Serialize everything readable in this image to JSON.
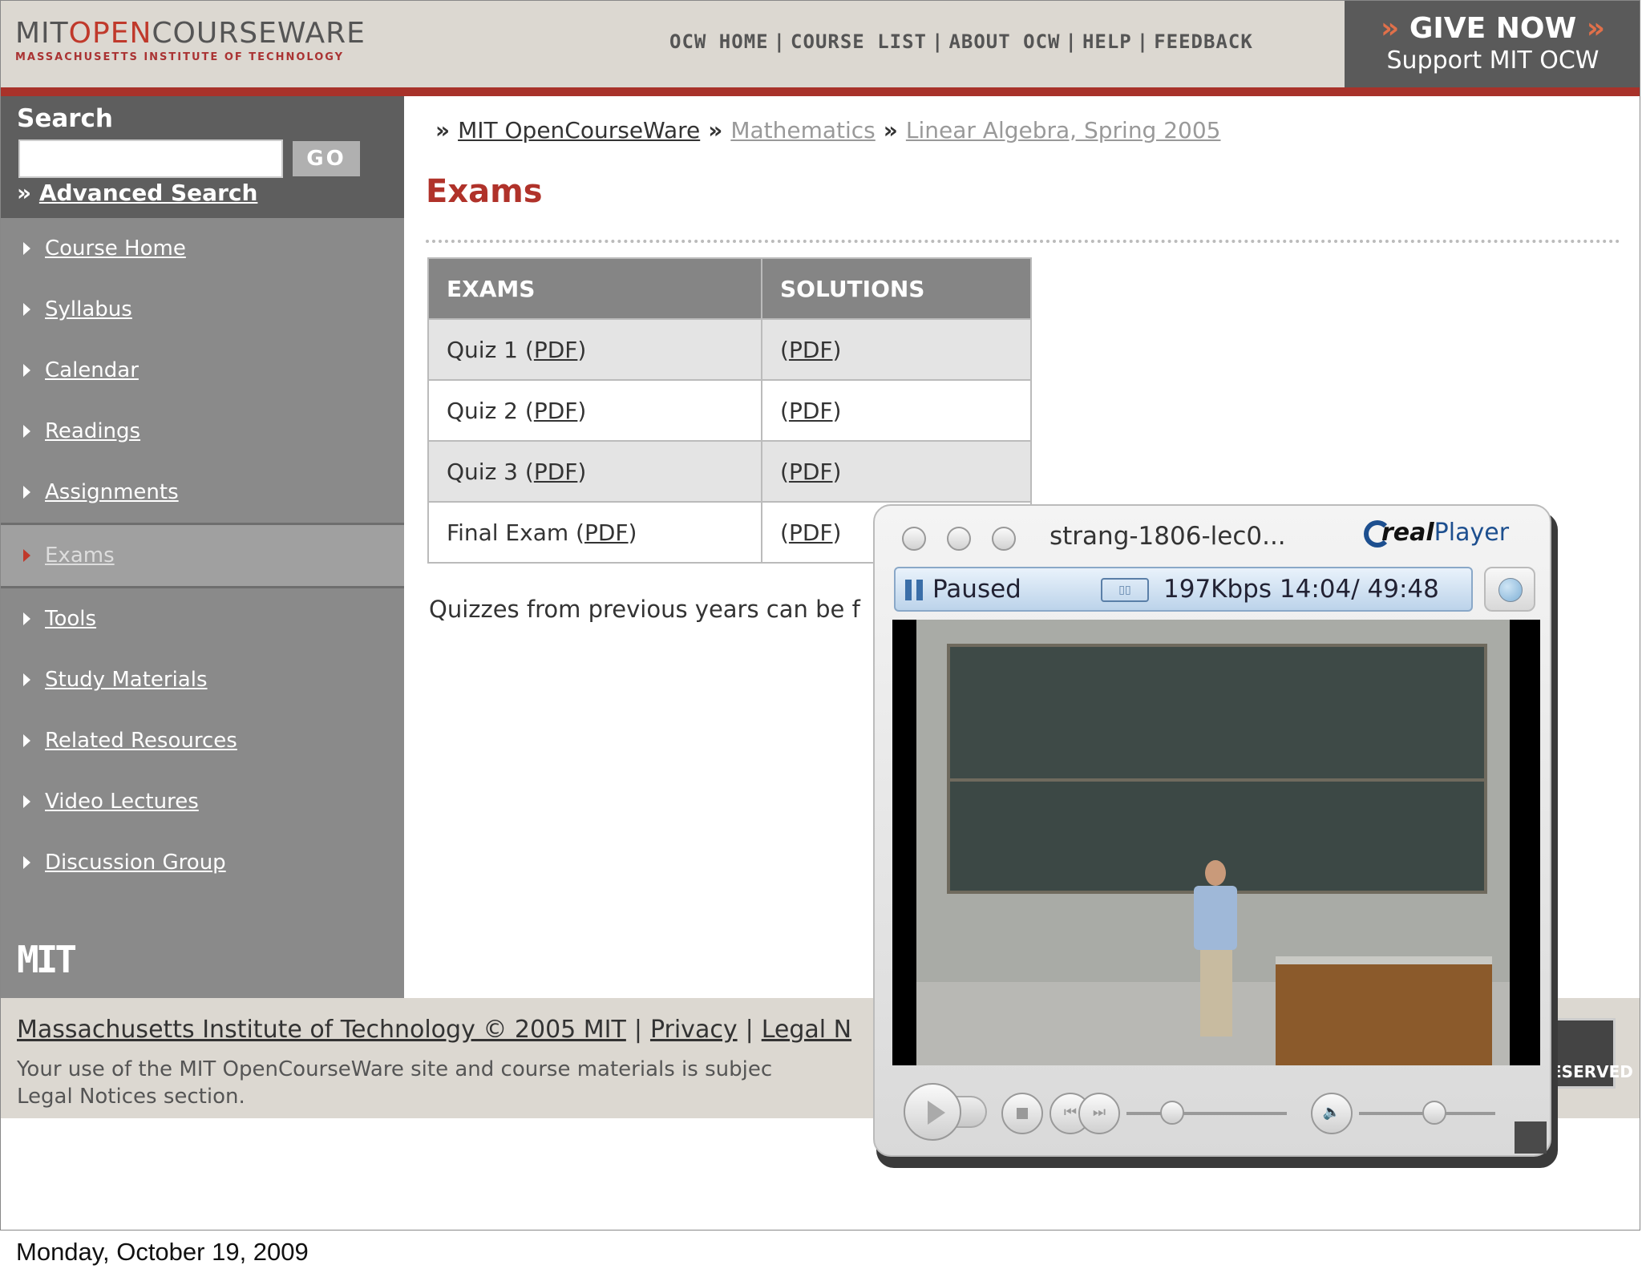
{
  "header": {
    "logo_mit": "MIT",
    "logo_open": "OPEN",
    "logo_courseware": "COURSEWARE",
    "logo_sub": "MASSACHUSETTS INSTITUTE OF TECHNOLOGY",
    "nav": [
      "OCW HOME",
      "COURSE LIST",
      "ABOUT OCW",
      "HELP",
      "FEEDBACK"
    ],
    "nav_separator": "|",
    "give_now": "GIVE NOW",
    "give_now_chevrons": "»",
    "give_now_sub": "Support MIT OCW"
  },
  "sidebar": {
    "search_label": "Search",
    "go_label": "GO",
    "advanced_prefix": "»",
    "advanced_search": "Advanced Search",
    "items": [
      {
        "label": "Course Home"
      },
      {
        "label": "Syllabus"
      },
      {
        "label": "Calendar"
      },
      {
        "label": "Readings"
      },
      {
        "label": "Assignments"
      },
      {
        "label": "Exams"
      },
      {
        "label": "Tools"
      },
      {
        "label": "Study Materials"
      },
      {
        "label": "Related Resources"
      },
      {
        "label": "Video Lectures"
      },
      {
        "label": "Discussion Group"
      }
    ],
    "active_item": "Exams",
    "mit_logo": "MIT"
  },
  "breadcrumb": {
    "sep": "»",
    "items": [
      "MIT OpenCourseWare",
      "Mathematics",
      "Linear Algebra, Spring 2005"
    ]
  },
  "page_title": "Exams",
  "exams_table": {
    "headers": [
      "EXAMS",
      "SOLUTIONS"
    ],
    "rows": [
      {
        "exam": "Quiz 1",
        "exam_link": "PDF",
        "solution_link": "PDF"
      },
      {
        "exam": "Quiz 2",
        "exam_link": "PDF",
        "solution_link": "PDF"
      },
      {
        "exam": "Quiz 3",
        "exam_link": "PDF",
        "solution_link": "PDF"
      },
      {
        "exam": "Final Exam",
        "exam_link": "PDF",
        "solution_link": "PDF"
      }
    ]
  },
  "note": "Quizzes from previous years can be f",
  "footer": {
    "copyright": "Massachusetts Institute of Technology © 2005 MIT",
    "privacy": "Privacy",
    "legal": "Legal N",
    "line2a": "Your use of the MIT OpenCourseWare site and course materials is subjec",
    "line2b": "Legal Notices section.",
    "badge": "ESERVED"
  },
  "player": {
    "title": "strang-1806-lec0...",
    "logo_real": "real",
    "logo_player": "Player",
    "status": "Paused",
    "content_type_icon": "clip-icon",
    "bitrate": "197Kbps",
    "time": "14:04/ 49:48",
    "position_fraction": 0.287,
    "volume_fraction": 0.55
  },
  "caption": "Monday, October 19, 2009",
  "colors": {
    "brand_red": "#a8322a",
    "header_bg": "#dcd8d1",
    "sidebar_bg": "#8a8a8a",
    "title_red": "#b0322a"
  }
}
